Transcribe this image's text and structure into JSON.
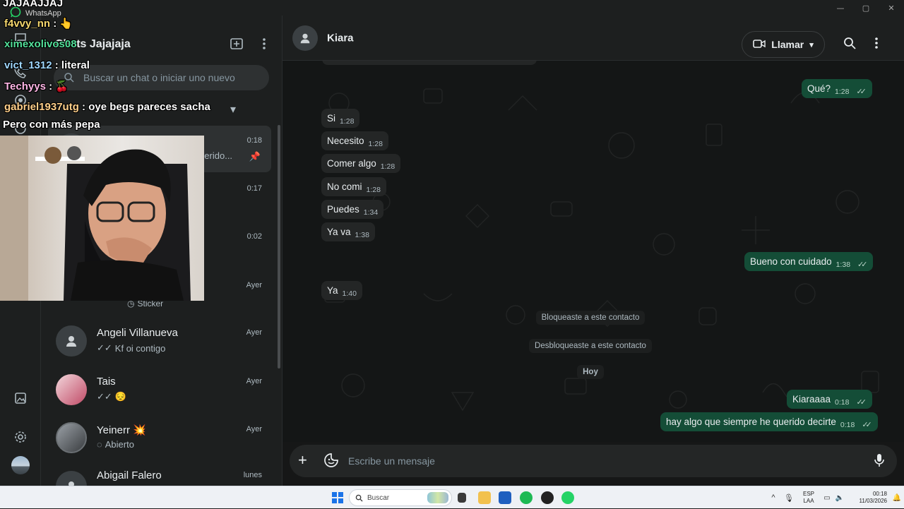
{
  "window": {
    "title": "WhatsApp",
    "controls": [
      "—",
      "▢",
      "✕"
    ]
  },
  "overlay": {
    "top_line": "JAJAAJJAJ",
    "lines": [
      {
        "user": "f4vvy_nn",
        "text": "👆"
      },
      {
        "user": "ximexolivos08",
        "text": ""
      },
      {
        "user": "vict_1312",
        "text": "literal"
      },
      {
        "user": "Techyys",
        "text": "🍒"
      },
      {
        "user": "gabriel1937utg",
        "text": "oye begs pareces sacha"
      }
    ],
    "tail": "Pero con más pepa"
  },
  "sidebar": {
    "title": "Chats Jajajaja",
    "search_placeholder": "Buscar un chat o iniciar uno nuevo",
    "chats": [
      {
        "name": "",
        "time": "0:18",
        "preview": "e querido..."
      },
      {
        "name": "",
        "time": "0:17",
        "preview": ""
      },
      {
        "name": "",
        "time": "0:02",
        "preview": ""
      },
      {
        "name": "",
        "time": "Ayer",
        "preview": "Sticker"
      },
      {
        "name": "Angeli Villanueva",
        "time": "Ayer",
        "preview": "Kf oi contigo"
      },
      {
        "name": "Tais",
        "time": "Ayer",
        "preview": "😔"
      },
      {
        "name": "Yeinerr 💥",
        "time": "Ayer",
        "preview": "Abierto"
      },
      {
        "name": "Abigail Falero",
        "time": "lunes",
        "preview": ""
      }
    ]
  },
  "conversation": {
    "contact": "Kiara",
    "call_label": "Llamar",
    "composer_placeholder": "Escribe un mensaje",
    "messages": [
      {
        "dir": "out",
        "text": "Qué?",
        "time": "1:28"
      },
      {
        "dir": "in",
        "text": "Si",
        "time": "1:28"
      },
      {
        "dir": "in",
        "text": "Necesito",
        "time": "1:28"
      },
      {
        "dir": "in",
        "text": "Comer algo",
        "time": "1:28"
      },
      {
        "dir": "in",
        "text": "No comi",
        "time": "1:28"
      },
      {
        "dir": "in",
        "text": "Puedes",
        "time": "1:34"
      },
      {
        "dir": "in",
        "text": "Ya va",
        "time": "1:38"
      },
      {
        "dir": "out",
        "text": "Bueno con cuidado",
        "time": "1:38"
      },
      {
        "dir": "in",
        "text": "Ya",
        "time": "1:40"
      },
      {
        "dir": "out",
        "text": "Kiaraaaa",
        "time": "0:18"
      },
      {
        "dir": "out",
        "text": "hay algo que siempre he querido decirte",
        "time": "0:18"
      }
    ],
    "system": [
      "Bloqueaste a este contacto",
      "Desbloqueaste a este contacto",
      "Hoy"
    ]
  },
  "taskbar": {
    "search_label": "Buscar",
    "lang_1": "ESP",
    "lang_2": "LAA",
    "clock_time": "00:18",
    "clock_date": "11/03/2026"
  }
}
